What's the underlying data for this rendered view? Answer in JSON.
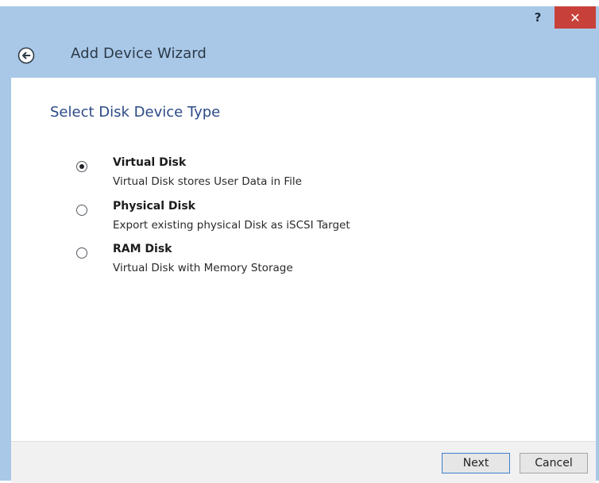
{
  "window": {
    "title": "Add Device Wizard",
    "help_label": "?",
    "close_label": "✕"
  },
  "page": {
    "heading": "Select Disk Device Type"
  },
  "options": [
    {
      "label": "Virtual Disk",
      "description": "Virtual Disk stores User Data in File",
      "selected": true
    },
    {
      "label": "Physical Disk",
      "description": "Export existing physical Disk as iSCSI Target",
      "selected": false
    },
    {
      "label": "RAM Disk",
      "description": "Virtual Disk with Memory Storage",
      "selected": false
    }
  ],
  "footer": {
    "next_label": "Next",
    "cancel_label": "Cancel"
  },
  "colors": {
    "titlebar": "#a9c8e8",
    "close_button": "#c8403a",
    "heading": "#2b4a86"
  }
}
